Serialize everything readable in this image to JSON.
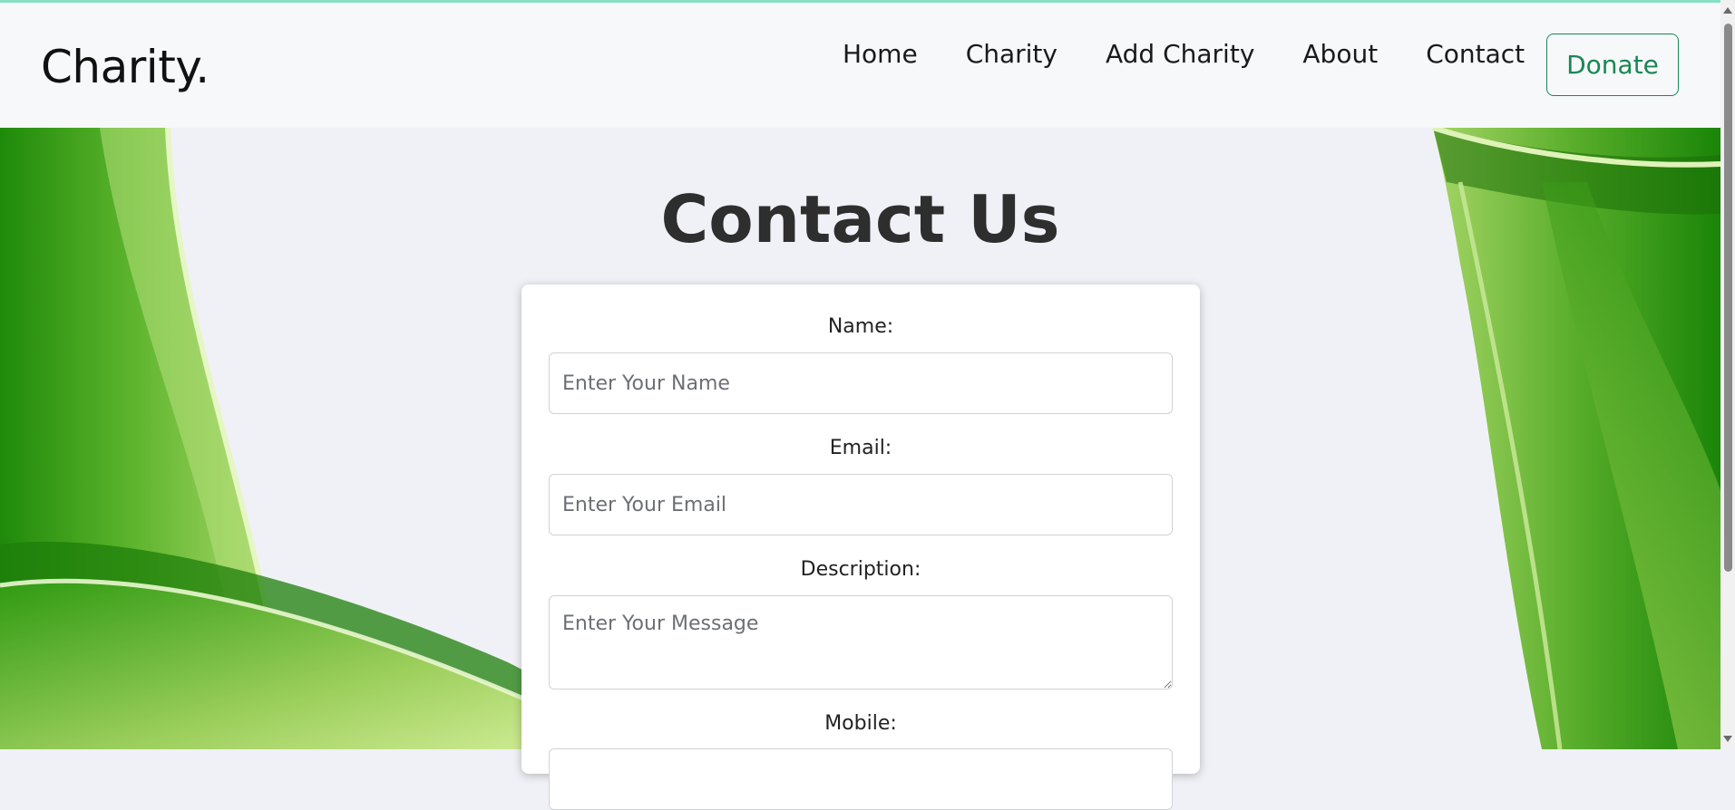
{
  "navbar": {
    "brand": "Charity.",
    "links": [
      "Home",
      "Charity",
      "Add Charity",
      "About",
      "Contact"
    ],
    "donate_label": "Donate"
  },
  "page": {
    "title": "Contact Us"
  },
  "form": {
    "name_label": "Name:",
    "name_placeholder": "Enter Your Name",
    "name_value": "",
    "email_label": "Email:",
    "email_placeholder": "Enter Your Email",
    "email_value": "",
    "description_label": "Description:",
    "description_placeholder": "Enter Your Message",
    "description_value": "",
    "mobile_label": "Mobile:"
  },
  "colors": {
    "accent_green": "#198754",
    "background": "#f0f1f6",
    "navbar": "#f7f8fa",
    "top_accent": "#86e0c4"
  }
}
